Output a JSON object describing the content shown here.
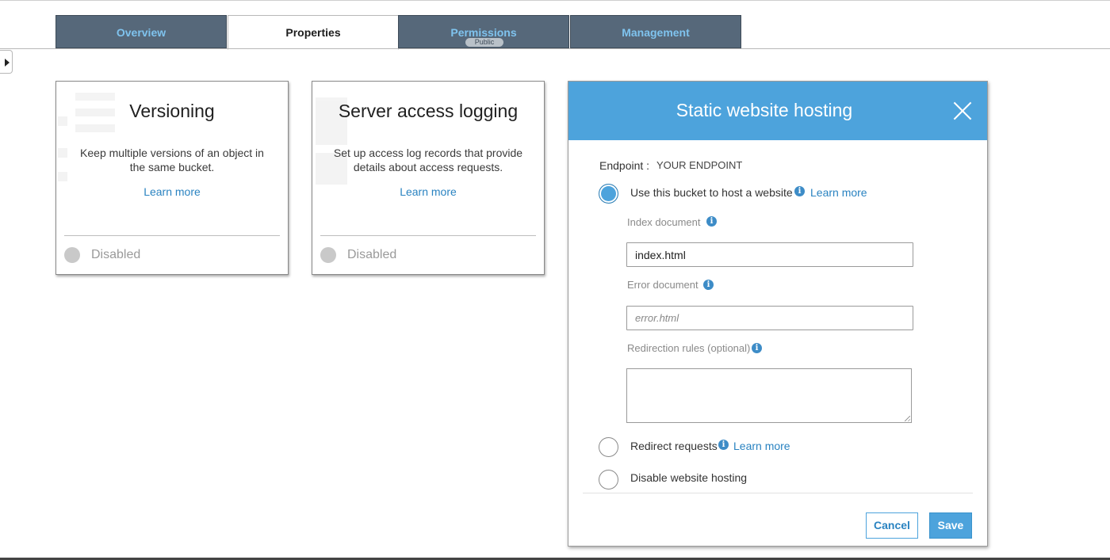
{
  "tabs": [
    {
      "label": "Overview"
    },
    {
      "label": "Properties"
    },
    {
      "label": "Permissions",
      "badge": "Public"
    },
    {
      "label": "Management"
    }
  ],
  "cards": {
    "versioning": {
      "title": "Versioning",
      "description": "Keep multiple versions of an object in the same bucket.",
      "learn_more": "Learn more",
      "status": "Disabled"
    },
    "logging": {
      "title": "Server access logging",
      "description": "Set up access log records that provide details about access requests.",
      "learn_more": "Learn more",
      "status": "Disabled"
    }
  },
  "hosting": {
    "title": "Static website hosting",
    "endpoint_label": "Endpoint :",
    "endpoint_value": "YOUR ENDPOINT",
    "option_host": "Use this bucket to host a website",
    "option_host_link": "Learn more",
    "index_label": "Index document",
    "index_value": "index.html",
    "error_label": "Error document",
    "error_placeholder": "error.html",
    "redirect_rules_label": "Redirection rules (optional)",
    "redirect_rules_value": "",
    "option_redirect": "Redirect requests",
    "option_redirect_link": "Learn more",
    "option_disable": "Disable website hosting",
    "selected_option": "Use this bucket to host a website",
    "cancel": "Cancel",
    "save": "Save"
  },
  "colors": {
    "accent": "#4da3dc",
    "link": "#2a83c1",
    "tab_bg": "#56687a",
    "tab_text": "#7fc3ee"
  }
}
